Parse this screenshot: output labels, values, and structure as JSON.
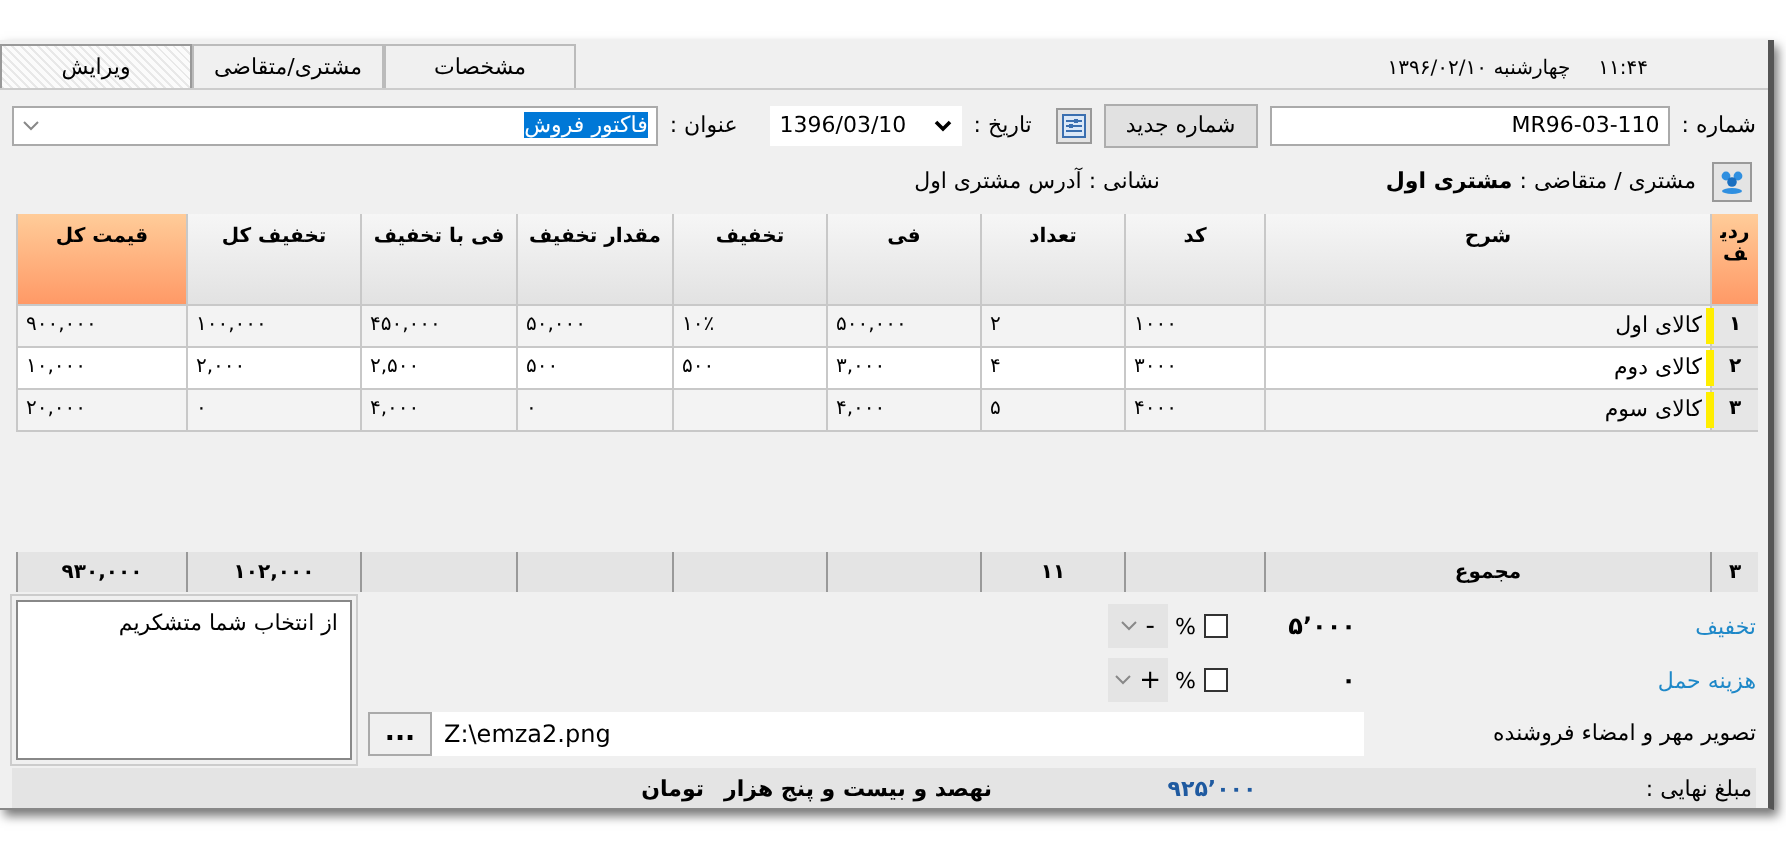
{
  "status": {
    "time": "۱۱:۴۴",
    "date": "چهارشنبه  ۱۳۹۶/۰۲/۱۰"
  },
  "tabs": [
    {
      "label": "مشخصات",
      "selected": false
    },
    {
      "label": "مشتری/متقاضی",
      "selected": false
    },
    {
      "label": "ویرایش",
      "selected": true
    }
  ],
  "form": {
    "number_label": "شماره :",
    "number": "MR96-03-110",
    "new_number_button": "شماره جدید",
    "date_label": "تاریخ :",
    "date": "1396/03/10",
    "title_label": "عنوان :",
    "title": {
      "value": "فاکتور فروش",
      "highlighted": true
    },
    "customer": "مشتری / متقاضی : **مشتری اول**",
    "address": "نشانی : آدرس مشتری اول"
  },
  "table": {
    "columns": [
      {
        "label": "ردیف",
        "highlighted": true
      },
      {
        "label": "شرح",
        "highlighted": false
      },
      {
        "label": "کد",
        "highlighted": false
      },
      {
        "label": "تعداد",
        "highlighted": false
      },
      {
        "label": "فی",
        "highlighted": false
      },
      {
        "label": "تخفیف",
        "highlighted": false
      },
      {
        "label": "مقدار تخفیف",
        "highlighted": false
      },
      {
        "label": "فی با تخفیف",
        "highlighted": false
      },
      {
        "label": "تخفیف کل",
        "highlighted": false
      },
      {
        "label": "قیمت کل",
        "highlighted": true
      }
    ],
    "rows": [
      {
        "cells": [
          "۱",
          "کالای اول",
          "۱۰۰۰",
          "۲",
          "۵۰۰,۰۰۰",
          "۱۰٪",
          "۵۰,۰۰۰",
          "۴۵۰,۰۰۰",
          "۱۰۰,۰۰۰",
          "۹۰۰,۰۰۰"
        ]
      },
      {
        "cells": [
          "۲",
          "کالای دوم",
          "۳۰۰۰",
          "۴",
          "۳,۰۰۰",
          "۵۰۰",
          "۵۰۰",
          "۲,۵۰۰",
          "۲,۰۰۰",
          "۱۰,۰۰۰"
        ]
      },
      {
        "cells": [
          "۳",
          "کالای سوم",
          "۴۰۰۰",
          "۵",
          "۴,۰۰۰",
          "",
          "۰",
          "۴,۰۰۰",
          "۰",
          "۲۰,۰۰۰"
        ]
      }
    ],
    "footer": {
      "cells": [
        "۳",
        "مجموع",
        "",
        "۱۱",
        "",
        "",
        "",
        "",
        "۱۰۲,۰۰۰",
        "۹۳۰,۰۰۰"
      ]
    }
  },
  "adjustments": [
    {
      "label": "تخفیف",
      "value": "۵٬۰۰۰",
      "percent": false,
      "percent_sign": "%",
      "sign": "-"
    },
    {
      "label": "هزینه حمل",
      "value": "۰",
      "percent": false,
      "percent_sign": "%",
      "sign": "+"
    }
  ],
  "signature": {
    "label": "تصویر مهر و امضاء فروشنده",
    "browse_button": "...",
    "path": "Z:\\emza2.png"
  },
  "note": "از انتخاب شما متشکریم",
  "total": {
    "label": "مبلغ نهایی :",
    "amount": "۹۲۵٬۰۰۰",
    "words": "نهصد و بیست و پنج هزار",
    "unit": "تومان"
  }
}
